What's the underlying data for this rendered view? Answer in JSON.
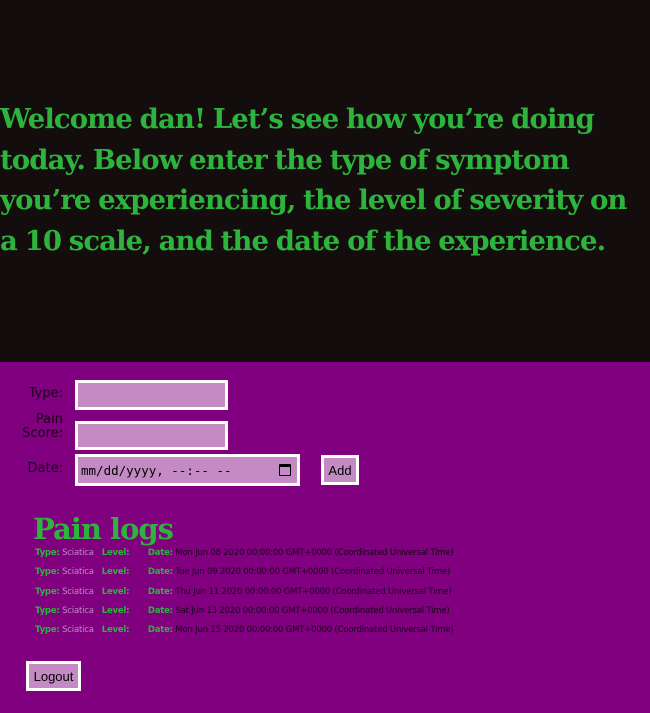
{
  "welcome": {
    "text": "Welcome dan! Let’s see how you’re doing today. Below enter the type of symptom you’re experiencing, the level of severity on a 10 scale, and the date of the experience."
  },
  "form": {
    "type_label": "Type:",
    "pain_label_1": "Pain",
    "pain_label_2": "Score:",
    "date_label": "Date:",
    "type_value": "",
    "pain_value": "",
    "date_placeholder": "mm/dd/yyyy, --:-- --",
    "add_label": "Add"
  },
  "logs": {
    "title": "Pain logs",
    "type_key": "Type:",
    "level_key": "Level:",
    "date_key": "Date:",
    "entries": [
      {
        "type": "Sciatica",
        "level": "",
        "date": "Mon Jun 08 2020 00:00:00 GMT+0000 (Coordinated Universal Time)"
      },
      {
        "type": "Sciatica",
        "level": "",
        "date": "Tue Jun 09 2020 00:00:00 GMT+0000 (Coordinated Universal Time)"
      },
      {
        "type": "Sciatica",
        "level": "",
        "date": "Thu Jun 11 2020 00:00:00 GMT+0000 (Coordinated Universal Time)"
      },
      {
        "type": "Sciatica",
        "level": "",
        "date": "Sat Jun 13 2020 00:00:00 GMT+0000 (Coordinated Universal Time)"
      },
      {
        "type": "Sciatica",
        "level": "",
        "date": "Mon Jun 15 2020 00:00:00 GMT+0000 (Coordinated Universal Time)"
      }
    ]
  },
  "logout_label": "Logout",
  "colors": {
    "hero_bg": "#140d0d",
    "page_bg": "#800080",
    "accent_green": "#2db43c",
    "field_bg": "#c48ac4"
  },
  "icons": {
    "date_picker": "calendar-icon"
  }
}
